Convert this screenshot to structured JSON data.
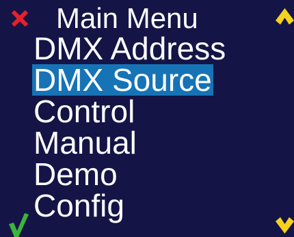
{
  "menu": {
    "title": "Main Menu",
    "items": [
      {
        "label": "DMX Address",
        "selected": false
      },
      {
        "label": "DMX Source",
        "selected": true
      },
      {
        "label": "Control",
        "selected": false
      },
      {
        "label": "Manual",
        "selected": false
      },
      {
        "label": "Demo",
        "selected": false
      },
      {
        "label": "Config",
        "selected": false
      }
    ]
  },
  "icons": {
    "cancel": "close-icon",
    "up": "chevron-up-icon",
    "confirm": "checkmark-icon",
    "down": "chevron-down-icon"
  },
  "colors": {
    "background": "#141546",
    "highlight": "#1673b6",
    "text": "#ffffff",
    "cancel": "#e8202a",
    "confirm": "#3cb43c",
    "arrows": "#f5d21e"
  }
}
